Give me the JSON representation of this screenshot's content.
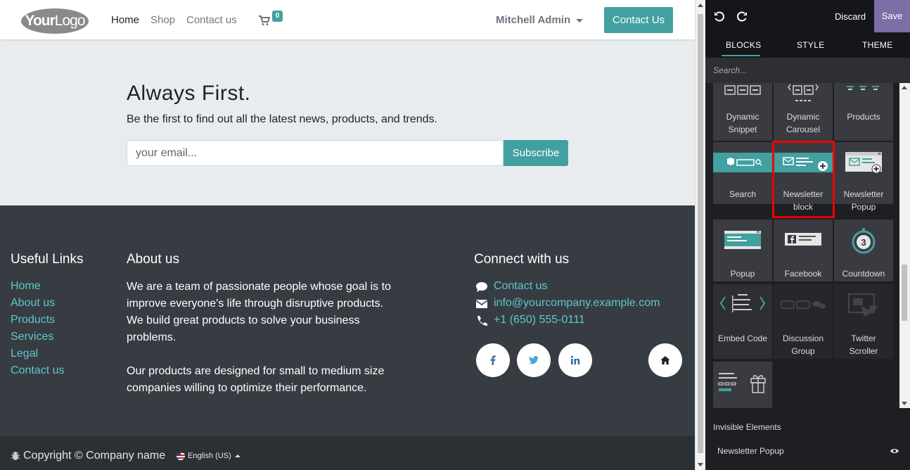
{
  "navbar": {
    "logo_text_bold": "Your",
    "logo_text": "Logo",
    "links": [
      "Home",
      "Shop",
      "Contact us"
    ],
    "cart_count": "0",
    "user": "Mitchell Admin",
    "contact_button": "Contact Us"
  },
  "newsletter": {
    "title": "Always First.",
    "subtitle": "Be the first to find out all the latest news, products, and trends.",
    "email_placeholder": "your email...",
    "subscribe_label": "Subscribe"
  },
  "footer": {
    "useful_links_title": "Useful Links",
    "useful_links": [
      "Home",
      "About us",
      "Products",
      "Services",
      "Legal",
      "Contact us"
    ],
    "about_title": "About us",
    "about_lines_1": [
      "We are a team of passionate people whose goal is to",
      "improve everyone's life through disruptive products.",
      "We build great products to solve your business",
      "problems."
    ],
    "about_lines_2": [
      "Our products are designed for small to medium size",
      "companies willing to optimize their performance."
    ],
    "connect_title": "Connect with us",
    "connect_contact": "Contact us",
    "connect_email": "info@yourcompany.example.com",
    "connect_phone": "+1 (650) 555-0111",
    "social_icons": [
      "facebook-icon",
      "twitter-icon",
      "linkedin-icon",
      "home-icon"
    ]
  },
  "copyright": {
    "text": "Copyright © Company name",
    "language": "English (US)"
  },
  "editor": {
    "discard_label": "Discard",
    "save_label": "Save",
    "tabs": [
      "BLOCKS",
      "STYLE",
      "THEME"
    ],
    "active_tab": "BLOCKS",
    "search_placeholder": "Search...",
    "blocks": [
      {
        "label_1": "Dynamic",
        "label_2": "Snippet",
        "icon": "dynamic-snippet-icon"
      },
      {
        "label_1": "Dynamic",
        "label_2": "Carousel",
        "icon": "dynamic-carousel-icon"
      },
      {
        "label_1": "Products",
        "label_2": "",
        "icon": "products-icon"
      },
      {
        "label_1": "Search",
        "label_2": "",
        "icon": "search-bar-icon"
      },
      {
        "label_1": "Newsletter",
        "label_2": "block",
        "icon": "newsletter-block-icon"
      },
      {
        "label_1": "Newsletter",
        "label_2": "Popup",
        "icon": "newsletter-popup-icon"
      },
      {
        "label_1": "Popup",
        "label_2": "",
        "icon": "popup-icon"
      },
      {
        "label_1": "Facebook",
        "label_2": "",
        "icon": "facebook-page-icon"
      },
      {
        "label_1": "Countdown",
        "label_2": "",
        "icon": "countdown-icon"
      },
      {
        "label_1": "Embed Code",
        "label_2": "",
        "icon": "embed-code-icon"
      },
      {
        "label_1": "Discussion",
        "label_2": "Group",
        "icon": "discussion-group-icon"
      },
      {
        "label_1": "Twitter",
        "label_2": "Scroller",
        "icon": "twitter-scroller-icon"
      },
      {
        "label_1": "",
        "label_2": "",
        "icon": "gift-block-icon"
      }
    ],
    "highlighted_block": "Newsletter block",
    "invisible_title": "Invisible Elements",
    "invisible_item": "Newsletter Popup",
    "accent_color": "#42a0a0",
    "save_color": "#7c6fa8",
    "highlight_color": "#ee0000"
  }
}
